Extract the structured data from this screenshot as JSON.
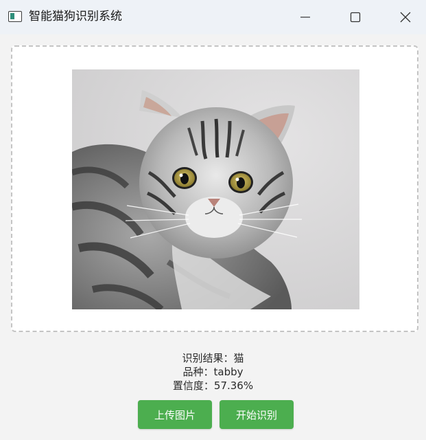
{
  "window": {
    "title": "智能猫狗识别系统",
    "icon": "app-window-icon"
  },
  "controls": {
    "minimize_icon": "minimize-icon",
    "maximize_icon": "maximize-icon",
    "close_icon": "close-icon"
  },
  "image_area": {
    "image_subject": "gray tabby kitten photo"
  },
  "results": {
    "result_label": "识别结果：",
    "result_value": "猫",
    "breed_label": "品种：",
    "breed_value": "tabby",
    "confidence_label": "置信度：",
    "confidence_value": "57.36%"
  },
  "buttons": {
    "upload_label": "上传图片",
    "start_label": "开始识别"
  },
  "colors": {
    "button_bg": "#4cae4f",
    "titlebar_bg": "#eef2f7",
    "window_bg": "#f3f3f3"
  }
}
